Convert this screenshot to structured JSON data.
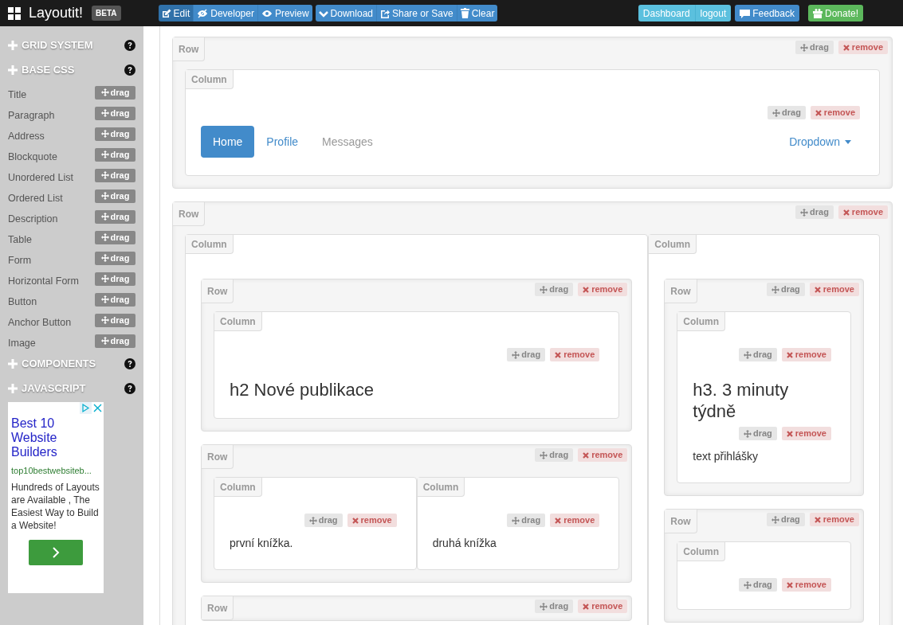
{
  "navbar": {
    "brand": "Layoutit!",
    "badge": "BETA",
    "left_groups": [
      {
        "buttons": [
          {
            "label": "Edit",
            "selected": true
          },
          {
            "label": "Developer",
            "selected": false
          },
          {
            "label": "Preview",
            "selected": false
          }
        ]
      },
      {
        "buttons": [
          {
            "label": "Download"
          },
          {
            "label": "Share or Save"
          },
          {
            "label": "Clear"
          }
        ]
      }
    ],
    "right_groups": [
      {
        "kind": "info",
        "buttons": [
          {
            "label": "Dashboard"
          },
          {
            "label": "logout"
          }
        ]
      },
      {
        "kind": "primary",
        "buttons": [
          {
            "label": "Feedback"
          }
        ]
      },
      {
        "kind": "success",
        "buttons": [
          {
            "label": "Donate!"
          }
        ]
      }
    ]
  },
  "sidebar": {
    "sections": [
      {
        "title": "GRID SYSTEM"
      },
      {
        "title": "BASE CSS",
        "items": [
          {
            "label": "Title",
            "drag": "drag"
          },
          {
            "label": "Paragraph",
            "drag": "drag"
          },
          {
            "label": "Address",
            "drag": "drag"
          },
          {
            "label": "Blockquote",
            "drag": "drag"
          },
          {
            "label": "Unordered List",
            "drag": "drag"
          },
          {
            "label": "Ordered List",
            "drag": "drag"
          },
          {
            "label": "Description",
            "drag": "drag"
          },
          {
            "label": "Table",
            "drag": "drag"
          },
          {
            "label": "Form",
            "drag": "drag"
          },
          {
            "label": "Horizontal Form",
            "drag": "drag"
          },
          {
            "label": "Button",
            "drag": "drag"
          },
          {
            "label": "Anchor Button",
            "drag": "drag"
          },
          {
            "label": "Image",
            "drag": "drag"
          }
        ]
      },
      {
        "title": "COMPONENTS"
      },
      {
        "title": "JAVASCRIPT"
      }
    ],
    "ad": {
      "title": "Best 10 Website Builders",
      "url": "top10bestwebsiteb...",
      "body": "Hundreds of Layouts are Available , The Easiest Way to Build a Website!"
    }
  },
  "canvas": {
    "rows": [
      {
        "label": "Row",
        "drag": "drag",
        "remove": "remove",
        "columns": [
          {
            "label": "Column",
            "items": [
              {
                "kind": "nav",
                "drag": "drag",
                "remove": "remove",
                "tabs": [
                  {
                    "label": "Home",
                    "selected": true,
                    "disabled": false
                  },
                  {
                    "label": "Profile",
                    "selected": false,
                    "disabled": false
                  },
                  {
                    "label": "Messages",
                    "selected": false,
                    "disabled": true
                  }
                ],
                "dropdown": "Dropdown"
              }
            ]
          }
        ]
      },
      {
        "label": "Row",
        "drag": "drag",
        "remove": "remove",
        "columns": [
          {
            "label": "Column",
            "items": [
              {
                "kind": "row",
                "label": "Row",
                "drag": "drag",
                "remove": "remove",
                "columns": [
                  {
                    "label": "Column",
                    "items": [
                      {
                        "kind": "heading",
                        "drag": "drag",
                        "remove": "remove",
                        "text": "h2 Nové publikace"
                      }
                    ]
                  }
                ]
              },
              {
                "kind": "row",
                "label": "Row",
                "drag": "drag",
                "remove": "remove",
                "columns": [
                  {
                    "label": "Column",
                    "items": [
                      {
                        "kind": "paragraph",
                        "drag": "drag",
                        "remove": "remove",
                        "text": "první knížka."
                      }
                    ]
                  },
                  {
                    "label": "Column",
                    "items": [
                      {
                        "kind": "paragraph",
                        "drag": "drag",
                        "remove": "remove",
                        "text": "druhá knížka"
                      }
                    ]
                  }
                ]
              },
              {
                "kind": "row",
                "label": "Row",
                "drag": "drag",
                "remove": "remove"
              }
            ]
          },
          {
            "label": "Column",
            "items": [
              {
                "kind": "row",
                "label": "Row",
                "drag": "drag",
                "remove": "remove",
                "columns": [
                  {
                    "label": "Column",
                    "items": [
                      {
                        "kind": "heading",
                        "drag": "drag",
                        "remove": "remove",
                        "text": "h3. 3 minuty týdně"
                      },
                      {
                        "kind": "paragraph",
                        "drag": "drag",
                        "remove": "remove",
                        "text": "text přihlášky"
                      }
                    ]
                  }
                ]
              },
              {
                "kind": "row",
                "label": "Row",
                "drag": "drag",
                "remove": "remove",
                "columns": [
                  {
                    "label": "Column",
                    "items": [
                      {
                        "kind": "paragraph",
                        "drag": "drag",
                        "remove": "remove"
                      }
                    ]
                  }
                ]
              }
            ]
          }
        ]
      }
    ]
  }
}
